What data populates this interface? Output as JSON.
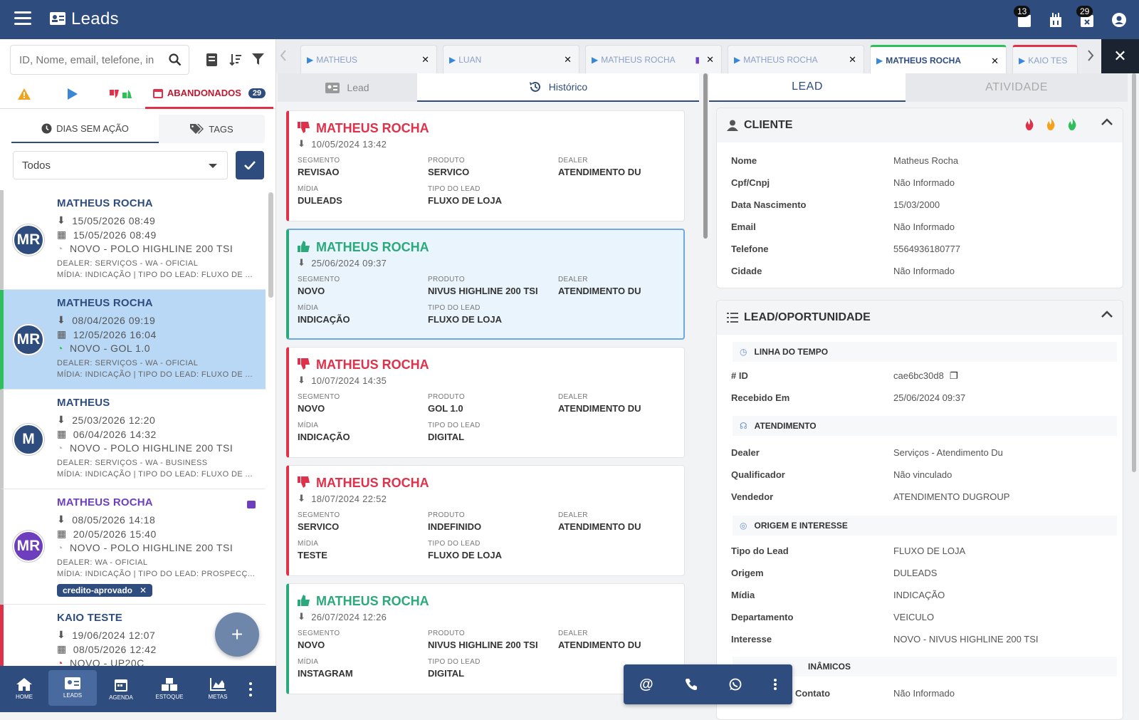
{
  "app": {
    "title": "Leads",
    "badge_calendar": "13",
    "badge_closed": "29"
  },
  "search": {
    "placeholder": "ID, Nome, email, telefone, in"
  },
  "filters": {
    "abandoned_label": "ABANDONADOS",
    "abandoned_count": "29"
  },
  "subtabs": {
    "days_label": "DIAS SEM AÇÃO",
    "tags_label": "TAGS"
  },
  "select": {
    "value": "Todos"
  },
  "leads": [
    {
      "initials": "MR",
      "name": "MATHEUS ROCHA",
      "date1": "15/05/2026 08:49",
      "date2": "15/05/2026 08:49",
      "vehicle": "NOVO - POLO HIGHLINE 200 TSI",
      "dealer": "DEALER: SERVIÇOS - WA - OFICIAL",
      "midia": "MÍDIA: INDICAÇÃO | TIPO DO LEAD: FLUXO DE ..."
    },
    {
      "initials": "MR",
      "name": "MATHEUS ROCHA",
      "date1": "08/04/2026 09:19",
      "date2": "12/05/2026 16:04",
      "vehicle": "NOVO - GOL 1.0",
      "dealer": "DEALER: SERVIÇOS - WA - OFICIAL",
      "midia": "MÍDIA: INDICAÇÃO | TIPO DO LEAD: FLUXO DE ..."
    },
    {
      "initials": "M",
      "name": "MATHEUS",
      "date1": "25/03/2026 12:20",
      "date2": "06/04/2026 14:32",
      "vehicle": "NOVO - POLO HIGHLINE 200 TSI",
      "dealer": "DEALER: SERVIÇOS - WA - BUSINESS",
      "midia": "MÍDIA: INDICAÇÃO | TIPO DO LEAD: FLUXO DE ..."
    },
    {
      "initials": "MR",
      "name": "MATHEUS ROCHA",
      "date1": "08/05/2026 14:18",
      "date2": "20/05/2026 15:40",
      "vehicle": "NOVO - POLO HIGHLINE 200 TSI",
      "dealer": "DEALER: WA - OFICIAL",
      "midia": "MÍDIA: INDICAÇÃO | TIPO DO LEAD: PROSPECÇ...",
      "tag": "credito-aprovado"
    },
    {
      "initials": "",
      "name": "KAIO TESTE",
      "date1": "19/06/2024 12:07",
      "date2": "08/05/2026 12:42",
      "vehicle": "NOVO - UP20C",
      "dealer": "",
      "midia": ""
    }
  ],
  "fab": {
    "label": "+"
  },
  "bottom_nav": [
    {
      "label": "HOME"
    },
    {
      "label": "LEADS"
    },
    {
      "label": "AGENDA"
    },
    {
      "label": "ESTOQUE"
    },
    {
      "label": "METAS"
    }
  ],
  "doc_tabs": [
    {
      "label": "MATHEUS"
    },
    {
      "label": "LUAN"
    },
    {
      "label": "MATHEUS ROCHA"
    },
    {
      "label": "MATHEUS ROCHA"
    },
    {
      "label": "MATHEUS ROCHA"
    },
    {
      "label": "KAIO TES"
    }
  ],
  "middle": {
    "tab_lead": "Lead",
    "tab_history": "Histórico"
  },
  "history": [
    {
      "name": "MATHEUS ROCHA",
      "date": "10/05/2024 13:42",
      "segmento": "REVISAO",
      "produto": "SERVICO",
      "dealer": "ATENDIMENTO DU",
      "midia": "DULEADS",
      "tipo": "FLUXO DE LOJA"
    },
    {
      "name": "MATHEUS ROCHA",
      "date": "25/06/2024 09:37",
      "segmento": "NOVO",
      "produto": "NIVUS HIGHLINE 200 TSI",
      "dealer": "ATENDIMENTO DU",
      "midia": "INDICAÇÃO",
      "tipo": "FLUXO DE LOJA"
    },
    {
      "name": "MATHEUS ROCHA",
      "date": "10/07/2024 14:35",
      "segmento": "NOVO",
      "produto": "GOL 1.0",
      "dealer": "ATENDIMENTO DU",
      "midia": "INDICAÇÃO",
      "tipo": "DIGITAL"
    },
    {
      "name": "MATHEUS ROCHA",
      "date": "18/07/2024 22:52",
      "segmento": "SERVICO",
      "produto": "INDEFINIDO",
      "dealer": "ATENDIMENTO DU",
      "midia": "TESTE",
      "tipo": "FLUXO DE LOJA"
    },
    {
      "name": "MATHEUS ROCHA",
      "date": "26/07/2024 12:26",
      "segmento": "NOVO",
      "produto": "NIVUS HIGHLINE 200 TSI",
      "dealer": "ATENDIMENTO DU",
      "midia": "INSTAGRAM",
      "tipo": "DIGITAL"
    }
  ],
  "history_labels": {
    "segmento": "SEGMENTO",
    "produto": "PRODUTO",
    "dealer": "DEALER",
    "midia": "MÍDIA",
    "tipo": "TIPO DO LEAD"
  },
  "right": {
    "tab_lead": "LEAD",
    "tab_activity": "ATIVIDADE"
  },
  "cliente": {
    "title": "CLIENTE",
    "fields": [
      {
        "k": "Nome",
        "v": "Matheus Rocha"
      },
      {
        "k": "Cpf/Cnpj",
        "v": "Não Informado"
      },
      {
        "k": "Data Nascimento",
        "v": "15/03/2000"
      },
      {
        "k": "Email",
        "v": "Não Informado"
      },
      {
        "k": "Telefone",
        "v": "5564936180777"
      },
      {
        "k": "Cidade",
        "v": "Não Informado"
      }
    ]
  },
  "oportunidade": {
    "title": "LEAD/OPORTUNIDADE",
    "timeline_title": "LINHA DO TEMPO",
    "id_key": "# ID",
    "id_value": "cae6bc30d8",
    "received_key": "Recebido Em",
    "received_value": "25/06/2024 09:37",
    "atendimento_title": "ATENDIMENTO",
    "atendimento": [
      {
        "k": "Dealer",
        "v": "Serviços - Atendimento Du"
      },
      {
        "k": "Qualificador",
        "v": "Não vinculado"
      },
      {
        "k": "Vendedor",
        "v": "ATENDIMENTO DUGROUP"
      }
    ],
    "origem_title": "ORIGEM E INTERESSE",
    "origem": [
      {
        "k": "Tipo do Lead",
        "v": "FLUXO DE LOJA"
      },
      {
        "k": "Origem",
        "v": "DULEADS"
      },
      {
        "k": "Mídia",
        "v": "INDICAÇÃO"
      },
      {
        "k": "Departamento",
        "v": "VEICULO"
      },
      {
        "k": "Interesse",
        "v": "NOVO - NIVUS HIGHLINE 200 TSI"
      }
    ],
    "dinamicos_title": "INÂMICOS",
    "contato_key": "Contato",
    "contato_value": "Não Informado"
  },
  "colors": {
    "primary": "#2e4c7e",
    "danger": "#e0314b",
    "success": "#2aa97a",
    "selected": "#b8d8f5"
  }
}
